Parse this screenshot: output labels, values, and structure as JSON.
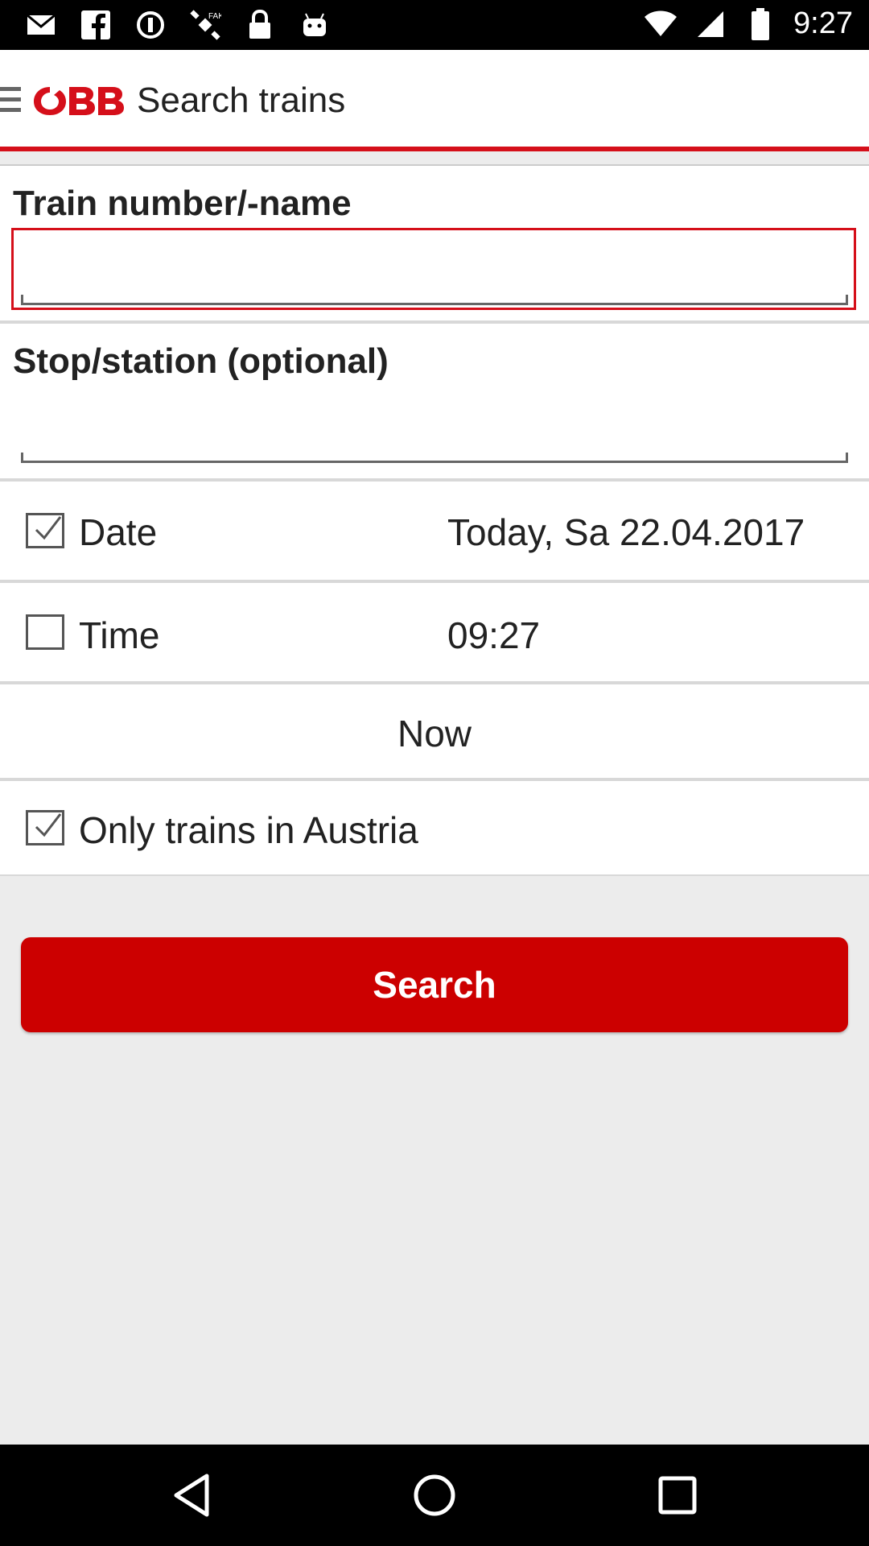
{
  "status_bar": {
    "time": "9:27",
    "left_icons": [
      "mail-icon",
      "facebook-icon",
      "sync-icon",
      "satellite-icon",
      "lock-icon",
      "android-icon"
    ],
    "right_icons": [
      "wifi-icon",
      "signal-icon",
      "battery-icon"
    ]
  },
  "app_bar": {
    "logo_text": "ÖBB",
    "title": "Search trains",
    "brand_color": "#d50f1a"
  },
  "train_section": {
    "label": "Train number/-name",
    "value": "",
    "placeholder": ""
  },
  "station_section": {
    "label": "Stop/station (optional)",
    "value": "",
    "placeholder": ""
  },
  "date_row": {
    "label": "Date",
    "checked": true,
    "value": "Today, Sa 22.04.2017"
  },
  "time_row": {
    "label": "Time",
    "checked": false,
    "value": "09:27"
  },
  "now_button": {
    "label": "Now"
  },
  "austria_row": {
    "label": "Only trains in Austria",
    "checked": true
  },
  "search_button": {
    "label": "Search",
    "color": "#cc0000"
  },
  "nav_bar": {
    "buttons": [
      "back-icon",
      "home-icon",
      "recents-icon"
    ]
  }
}
